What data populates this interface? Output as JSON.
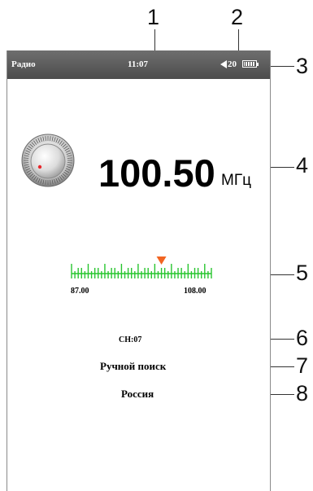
{
  "status_bar": {
    "title": "Радио",
    "time": "11:07",
    "volume": "20",
    "speaker_icon": "speaker-icon",
    "battery_icon": "battery-icon",
    "background": "#555555"
  },
  "tuner": {
    "frequency": "100.50",
    "unit": "МГц",
    "knob_icon": "tuning-knob-icon",
    "knob_indicator_color": "#e8262b"
  },
  "scale": {
    "min_label": "87.00",
    "max_label": "108.00",
    "min": 87.0,
    "max": 108.0,
    "current": 100.5,
    "tick_color": "#27c52e",
    "marker_color": "#f26522"
  },
  "channel": "CH:07",
  "menu": {
    "manual_search": "Ручной поиск",
    "region": "Россия"
  },
  "callouts": [
    "1",
    "2",
    "3",
    "4",
    "5",
    "6",
    "7",
    "8"
  ]
}
